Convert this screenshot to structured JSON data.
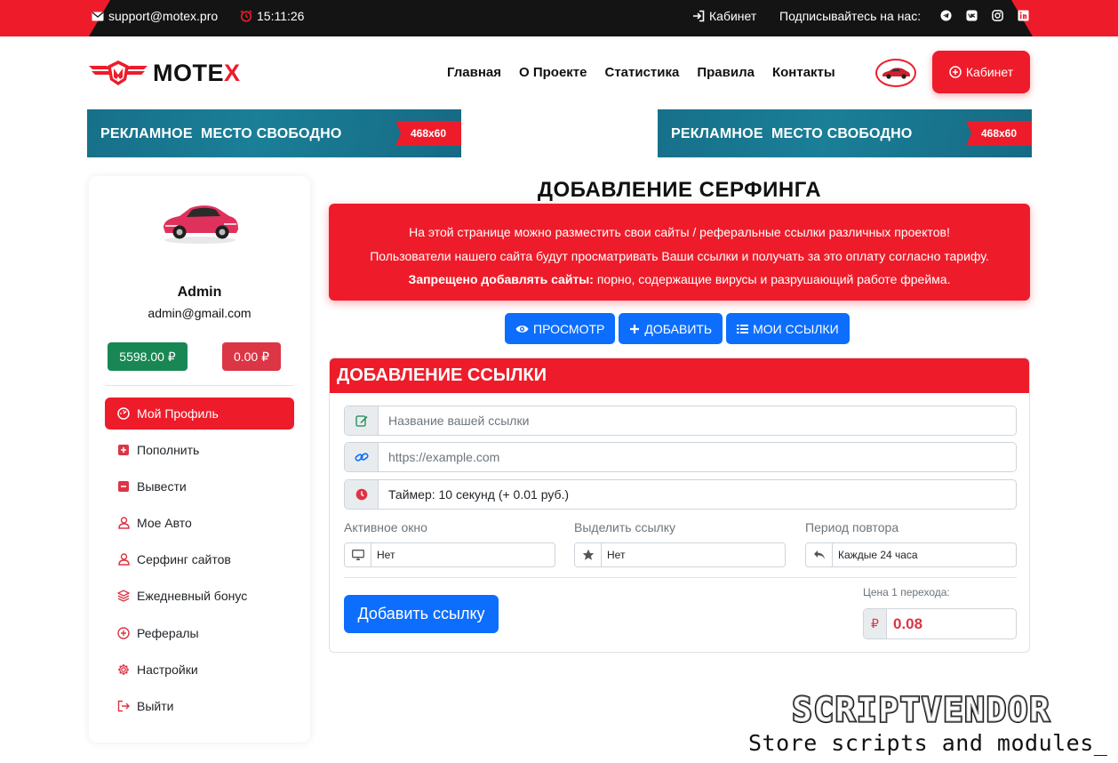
{
  "topbar": {
    "email": "support@motex.pro",
    "time": "15:11:26",
    "cabinet_link": "Кабинет",
    "follow_label": "Подписывайтесь на нас:",
    "social_icons": [
      "telegram-icon",
      "vk-icon",
      "instagram-icon",
      "linkedin-icon"
    ]
  },
  "header": {
    "logo_text_main": "MOTE",
    "logo_text_accent": "X",
    "nav": [
      "Главная",
      "О Проекте",
      "Статистика",
      "Правила",
      "Контакты"
    ],
    "cabinet_button": "Кабинет"
  },
  "banners": [
    {
      "text": "РЕКЛАМНОЕ  МЕСТО СВОБОДНО",
      "size": "468x60"
    },
    {
      "text": "РЕКЛАМНОЕ  МЕСТО СВОБОДНО",
      "size": "468x60"
    }
  ],
  "sidebar": {
    "name": "Admin",
    "email": "admin@gmail.com",
    "balance_main": "5598.00 ₽",
    "balance_ads": "0.00 ₽",
    "menu": [
      {
        "label": "Мой Профиль",
        "icon": "dashboard-icon",
        "active": true
      },
      {
        "label": "Пополнить",
        "icon": "plus-square-icon"
      },
      {
        "label": "Вывести",
        "icon": "minus-square-icon"
      },
      {
        "label": "Мое Авто",
        "icon": "user-icon"
      },
      {
        "label": "Серфинг сайтов",
        "icon": "user-icon"
      },
      {
        "label": "Ежедневный бонус",
        "icon": "layers-icon"
      },
      {
        "label": "Рефералы",
        "icon": "plus-circle-icon"
      },
      {
        "label": "Настройки",
        "icon": "gear-icon"
      },
      {
        "label": "Выйти",
        "icon": "logout-icon"
      }
    ]
  },
  "main": {
    "title": "ДОБАВЛЕНИЕ СЕРФИНГА",
    "alert_line1": "На этой странице можно разместить свои сайты / реферальные ссылки различных проектов!",
    "alert_line2": "Пользователи нашего сайта будут просматривать Ваши ссылки и получать за это оплату согласно тарифу.",
    "alert_line3_bold": "Запрещено добавлять сайты:",
    "alert_line3_rest": " порно, содержащие вирусы и разрушающий работе фрейма.",
    "buttons": {
      "view": "ПРОСМОТР",
      "add": "ДОБАВИТЬ",
      "my_links": "МОИ ССЫЛКИ"
    },
    "card_title": "ДОБАВЛЕНИЕ ССЫЛКИ",
    "name_placeholder": "Название вашей ссылки",
    "url_placeholder": "https://example.com",
    "timer_value": "Таймер: 10 секунд (+ 0.01 руб.)",
    "active_window_label": "Активное окно",
    "active_window_value": "Нет",
    "highlight_label": "Выделить ссылку",
    "highlight_value": "Нет",
    "repeat_label": "Период повтора",
    "repeat_value": "Каждые 24 часа",
    "submit_label": "Добавить ссылку",
    "price_label": "Цена 1 перехода:",
    "price_currency": "₽",
    "price_value": "0.08"
  },
  "watermark": {
    "title": "SCRIPTVENDOR",
    "subtitle": "Store scripts and modules_"
  }
}
